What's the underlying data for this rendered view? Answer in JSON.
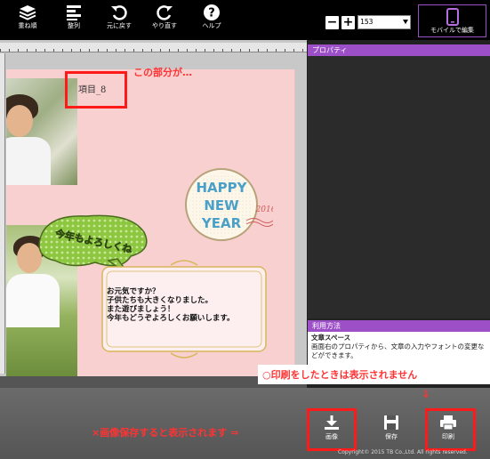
{
  "toolbar": {
    "layers_label": "重ね順",
    "align_label": "整列",
    "undo_label": "元に戻す",
    "redo_label": "やり直す",
    "help_label": "ヘルプ",
    "zoom_minus": "−",
    "zoom_plus": "+",
    "zoom_value": "153",
    "mobile_label": "モバイルで編集"
  },
  "canvas": {
    "item_label": "項目_8",
    "callout_item": "この部分が…",
    "bubble_text": "今年もよろしくね",
    "stamp_line1": "HAPPY",
    "stamp_line2": "NEW",
    "stamp_line3": "YEAR",
    "stamp_year": "2016",
    "message": "お元気ですか？\n子供たちも大きくなりました。\nまた遊びましょう！\n今年もどうぞよろしくお願いします。"
  },
  "panel": {
    "properties_title": "プロパティ",
    "usage_title": "利用方法",
    "usage_heading": "文章スペース",
    "usage_text": "画面右のプロパティから、文章の入力やフォントの変更などができます。"
  },
  "bottom": {
    "save_image_label": "画像",
    "save_label": "保存",
    "print_label": "印刷",
    "callout_save": "×画像保存すると表示されます ⇒",
    "callout_print": "○印刷をしたときは表示されません",
    "arrow": "⇓",
    "copyright": "Copyright© 2015 TB Co.,Ltd. All rights reserved."
  },
  "colors": {
    "accent": "#9d4fc7",
    "highlight": "#ff1a1a",
    "card_bg": "#f9d0d0"
  }
}
